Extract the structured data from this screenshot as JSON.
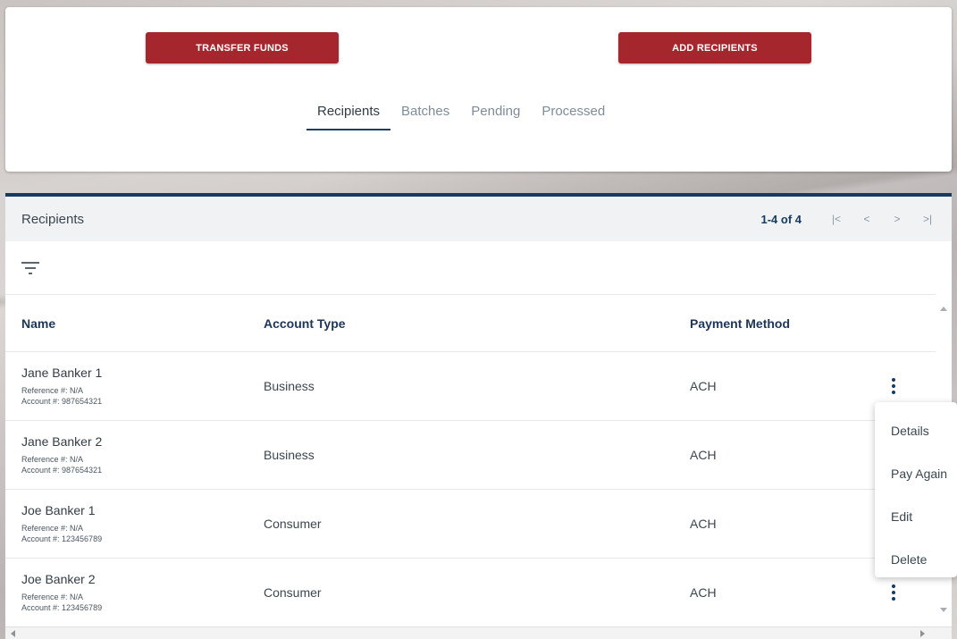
{
  "actions": {
    "transfer_label": "TRANSFER FUNDS",
    "add_label": "ADD RECIPIENTS"
  },
  "tabs": [
    {
      "label": "Recipients",
      "active": true
    },
    {
      "label": "Batches",
      "active": false
    },
    {
      "label": "Pending",
      "active": false
    },
    {
      "label": "Processed",
      "active": false
    }
  ],
  "panel": {
    "title": "Recipients",
    "pager": {
      "count": "1-4 of 4",
      "first": "|<",
      "prev": "<",
      "next": ">",
      "last": ">|"
    }
  },
  "table": {
    "headers": {
      "name": "Name",
      "account_type": "Account Type",
      "payment_method": "Payment Method"
    },
    "rows": [
      {
        "name": "Jane Banker 1",
        "reference": "Reference #: N/A",
        "account": "Account #: 987654321",
        "account_type": "Business",
        "payment_method": "ACH"
      },
      {
        "name": "Jane Banker 2",
        "reference": "Reference #: N/A",
        "account": "Account #: 987654321",
        "account_type": "Business",
        "payment_method": "ACH"
      },
      {
        "name": "Joe Banker 1",
        "reference": "Reference #: N/A",
        "account": "Account #: 123456789",
        "account_type": "Consumer",
        "payment_method": "ACH"
      },
      {
        "name": "Joe Banker 2",
        "reference": "Reference #: N/A",
        "account": "Account #: 123456789",
        "account_type": "Consumer",
        "payment_method": "ACH"
      }
    ]
  },
  "context_menu": {
    "items": [
      "Details",
      "Pay Again",
      "Edit",
      "Delete"
    ]
  },
  "colors": {
    "accent_red": "#a6262d",
    "navy": "#173a63"
  }
}
